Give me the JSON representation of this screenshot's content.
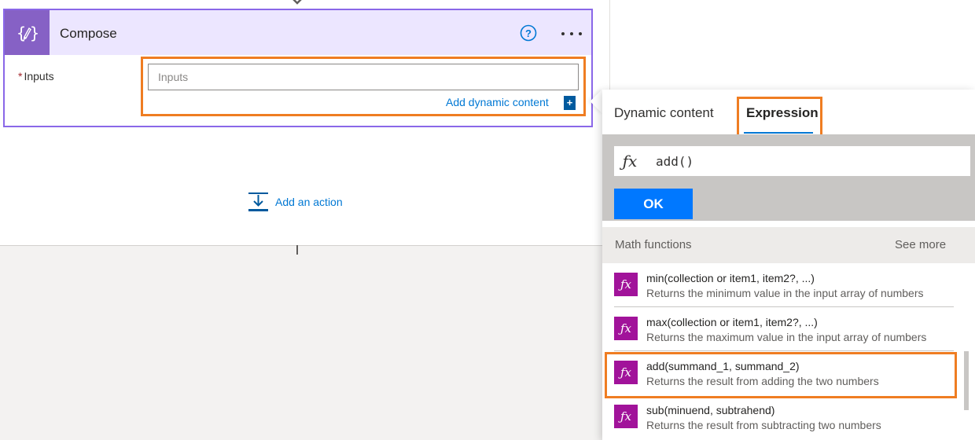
{
  "colors": {
    "accent_purple": "#8a67e8",
    "header_bg": "#ece6ff",
    "highlight_orange": "#ef7d22",
    "link_blue": "#0078d4",
    "ok_blue": "#0078ff",
    "fn_icon_magenta": "#a1139a"
  },
  "compose": {
    "title": "Compose",
    "icon": "compose-braces-icon",
    "help_icon": "help-circle-icon",
    "more_icon": "more-dots-icon",
    "field": {
      "label": "Inputs",
      "required_marker": "*",
      "placeholder": "Inputs",
      "value": ""
    },
    "dynamic_content_link": "Add dynamic content",
    "dynamic_content_plus": "+"
  },
  "canvas": {
    "add_action_label": "Add an action",
    "add_action_icon": "add-action-icon"
  },
  "flyout": {
    "tabs": [
      {
        "label": "Dynamic content",
        "selected": false
      },
      {
        "label": "Expression",
        "selected": true
      }
    ],
    "expression": {
      "fx_symbol": "fx",
      "value": "add()",
      "ok_label": "OK"
    },
    "section": {
      "title": "Math functions",
      "see_more": "See more"
    },
    "functions": [
      {
        "name": "min(collection or item1, item2?, ...)",
        "description": "Returns the minimum value in the input array of numbers"
      },
      {
        "name": "max(collection or item1, item2?, ...)",
        "description": "Returns the maximum value in the input array of numbers"
      },
      {
        "name": "add(summand_1, summand_2)",
        "description": "Returns the result from adding the two numbers",
        "highlighted": true
      },
      {
        "name": "sub(minuend, subtrahend)",
        "description": "Returns the result from subtracting two numbers"
      }
    ]
  }
}
